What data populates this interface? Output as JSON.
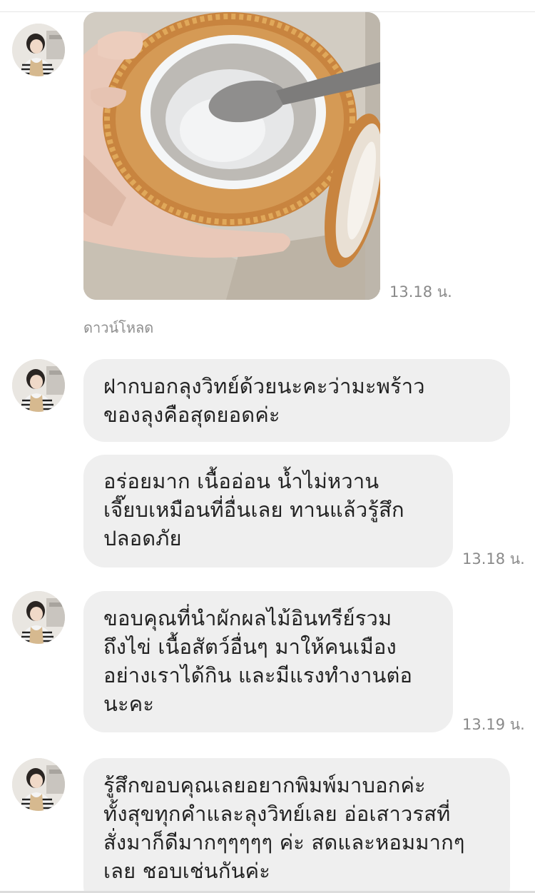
{
  "conversation": {
    "image_message": {
      "photo_alt": "coconut",
      "time": "13.18 น.",
      "download_label": "ดาวน์โหลด"
    },
    "messages": [
      {
        "lines": [
          "ฝากบอกลุงวิทย์ด้วยนะคะว่ามะพร้าว",
          "ของลุงคือสุดยอดค่ะ"
        ],
        "time": ""
      },
      {
        "lines": [
          "อร่อยมาก เนื้ออ่อน น้ำไม่หวาน",
          "เจี๊ยบเหมือนที่อื่นเลย ทานแล้วรู้สึก",
          "ปลอดภัย"
        ],
        "time": "13.18 น."
      },
      {
        "lines": [
          "ขอบคุณที่นำผักผลไม้อินทรีย์รวม",
          "ถึงไข่ เนื้อสัตว์อื่นๆ มาให้คนเมือง",
          "อย่างเราได้กิน และมีแรงทำงานต่อ",
          "นะคะ"
        ],
        "time": "13.19 น."
      },
      {
        "lines": [
          "รู้สึกขอบคุณเลยอยากพิมพ์มาบอกค่ะ",
          "ทั้งสุขทุกคำและลุงวิทย์เลย อ่อเสาวรสที่",
          "สั่งมาก็ดีมากๆๆๆๆๆ ค่ะ สดและหอมมากๆ",
          "เลย ชอบเช่นกันค่ะ"
        ],
        "time": ""
      }
    ]
  },
  "colors": {
    "bubble_background": "#efefef",
    "text": "#222222",
    "timestamp": "#8a8a8a"
  }
}
